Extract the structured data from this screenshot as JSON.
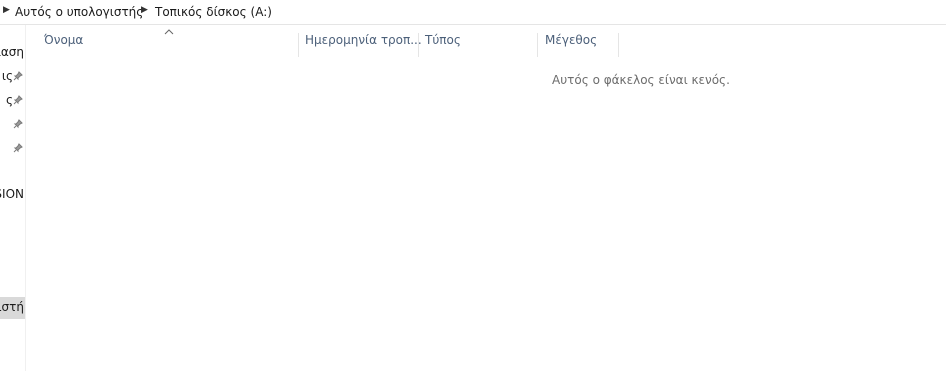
{
  "breadcrumb": {
    "items": [
      {
        "label": "Αυτός ο υπολογιστής"
      },
      {
        "label": "Τοπικός δίσκος (A:)"
      }
    ]
  },
  "nav": {
    "items": [
      {
        "label": "ιαση",
        "pinned": false
      },
      {
        "label": "ις",
        "pinned": true
      },
      {
        "label": "ς",
        "pinned": true
      },
      {
        "label": "",
        "pinned": true
      },
      {
        "label": "",
        "pinned": true
      },
      {
        "label": "SSION",
        "pinned": false
      },
      {
        "label": "ιστή",
        "pinned": false,
        "selected": true
      }
    ]
  },
  "columns": {
    "name": "Όνομα",
    "date": "Ημερομηνία τροπ...",
    "type": "Τύπος",
    "size": "Μέγεθος"
  },
  "empty_message": "Αυτός ο φάκελος είναι κενός.",
  "colors": {
    "header_text": "#4c607a",
    "empty_text": "#6d6d6d",
    "selected_bg": "#d9d9d9"
  }
}
